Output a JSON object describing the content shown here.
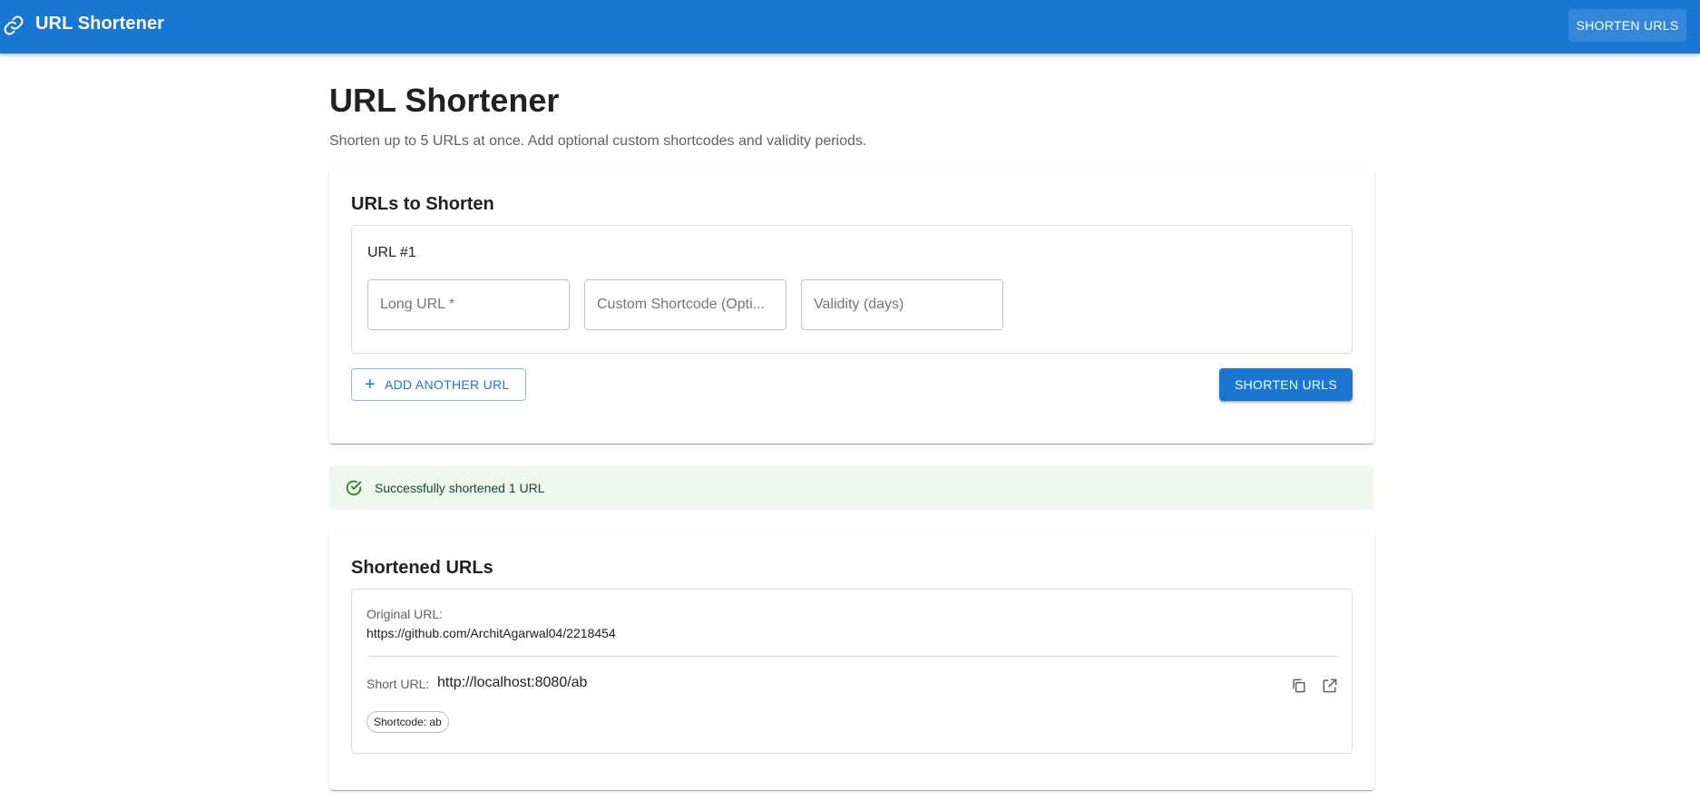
{
  "appbar": {
    "title": "URL Shortener",
    "nav_button": "SHORTEN URLS",
    "icon": "link-icon",
    "color": "#1976d2"
  },
  "page": {
    "title": "URL Shortener",
    "subtitle": "Shorten up to 5 URLs at once. Add optional custom shortcodes and validity periods."
  },
  "form": {
    "title": "URLs to Shorten",
    "entries": [
      {
        "label": "URL #1",
        "long_url_placeholder": "Long URL *",
        "shortcode_placeholder": "Custom Shortcode (Opti...",
        "validity_placeholder": "Validity (days)"
      }
    ],
    "add_button": "ADD ANOTHER URL",
    "submit_button": "SHORTEN URLS"
  },
  "alert": {
    "message": "Successfully shortened 1 URL",
    "icon": "check-circle-icon",
    "color": "#2e7d32"
  },
  "results": {
    "title": "Shortened URLs",
    "items": [
      {
        "original_label": "Original URL:",
        "original_url": "https://github.com/ArchitAgarwal04/2218454",
        "short_label": "Short URL:",
        "short_url": "http://localhost:8080/ab",
        "shortcode_chip": "Shortcode: ab"
      }
    ]
  }
}
